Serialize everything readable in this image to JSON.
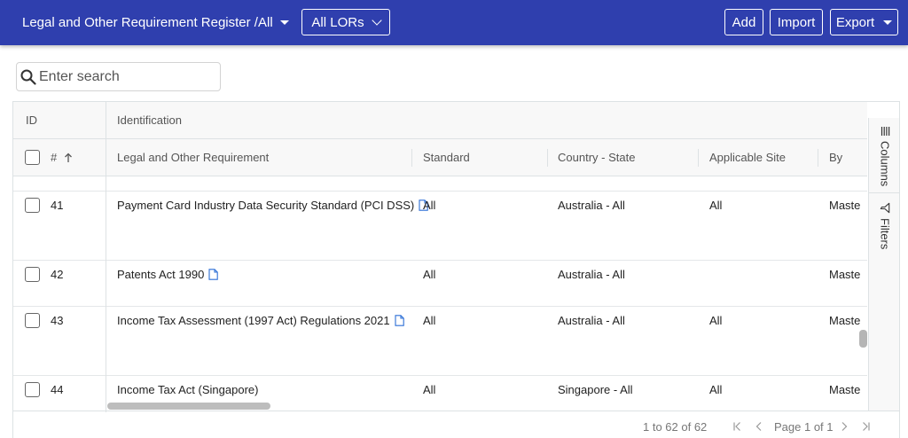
{
  "header": {
    "title": "Legal and Other Requirement Register /",
    "filter_value": "All",
    "lor_select": "All LORs",
    "add_label": "Add",
    "import_label": "Import",
    "export_label": "Export",
    "bar_color": "#2f3fae"
  },
  "search": {
    "placeholder": "Enter search"
  },
  "grid": {
    "group_headers": {
      "id": "ID",
      "identification": "Identification"
    },
    "columns": {
      "num": "#",
      "requirement": "Legal and Other Requirement",
      "standard": "Standard",
      "country": "Country - State",
      "site": "Applicable Site",
      "by": "By"
    },
    "rows": [
      {
        "num": "41",
        "requirement": "Payment Card Industry Data Security Standard (PCI DSS)",
        "standard": "All",
        "country": "Australia - All",
        "site": "All",
        "by": "Maste"
      },
      {
        "num": "42",
        "requirement": "Patents Act 1990",
        "standard": "All",
        "country": "Australia - All",
        "site": "",
        "by": "Maste"
      },
      {
        "num": "43",
        "requirement": "Income Tax Assessment (1997 Act) Regulations 2021",
        "standard": "All",
        "country": "Australia - All",
        "site": "All",
        "by": "Maste"
      },
      {
        "num": "44",
        "requirement": "Income Tax Act (Singapore)",
        "standard": "All",
        "country": "Singapore - All",
        "site": "All",
        "by": "Maste"
      }
    ],
    "side_panel": {
      "columns_label": "Columns",
      "filters_label": "Filters"
    },
    "pagination": {
      "summary": "1 to 62 of 62",
      "page_label": "Page 1 of 1"
    }
  }
}
